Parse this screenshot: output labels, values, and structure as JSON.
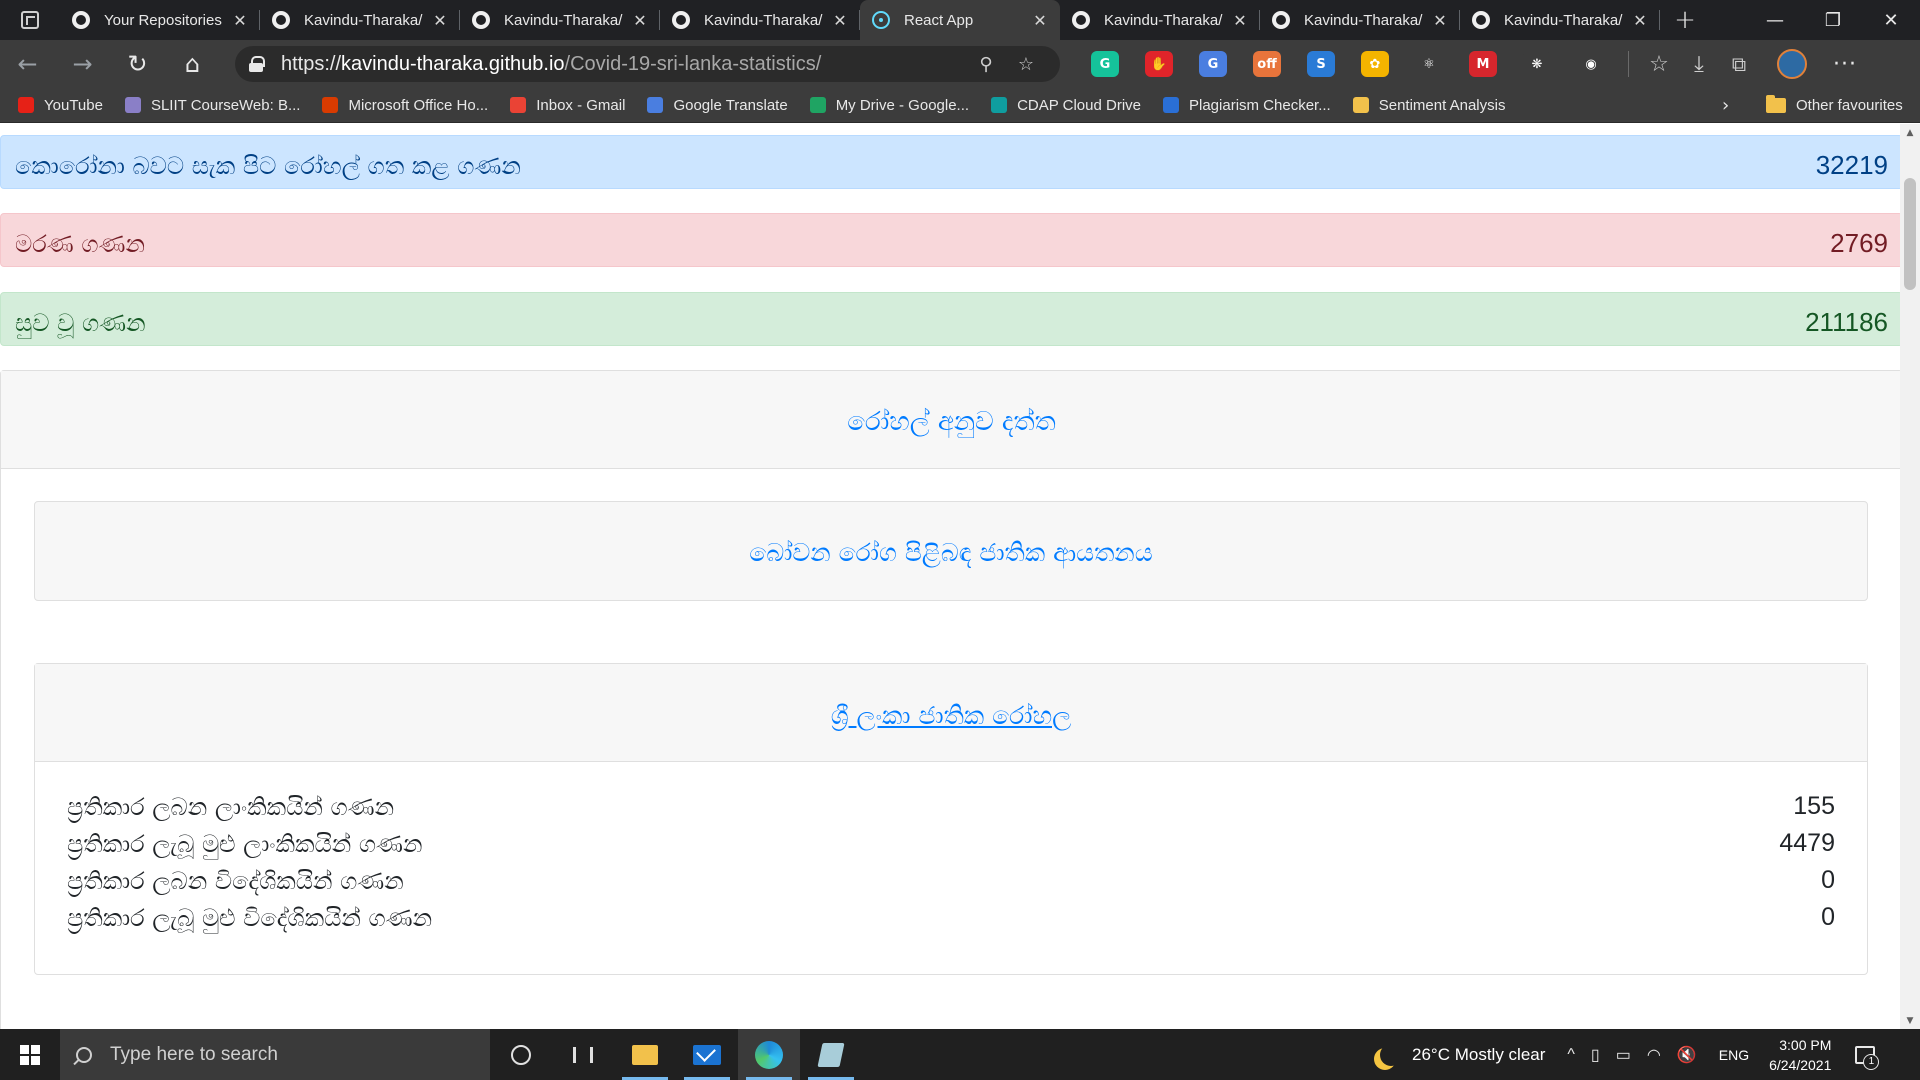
{
  "browser": {
    "tabs": [
      {
        "title": "Your Repositories",
        "icon": "github-icon",
        "active": false
      },
      {
        "title": "Kavindu-Tharaka/",
        "icon": "github-icon",
        "active": false
      },
      {
        "title": "Kavindu-Tharaka/",
        "icon": "github-icon",
        "active": false
      },
      {
        "title": "Kavindu-Tharaka/",
        "icon": "github-icon",
        "active": false
      },
      {
        "title": "React App",
        "icon": "react-icon",
        "active": true
      },
      {
        "title": "Kavindu-Tharaka/",
        "icon": "github-icon",
        "active": false
      },
      {
        "title": "Kavindu-Tharaka/",
        "icon": "github-icon",
        "active": false
      },
      {
        "title": "Kavindu-Tharaka/",
        "icon": "github-icon",
        "active": false
      }
    ],
    "tab_close_glyph": "✕",
    "new_tab_glyph": "+",
    "window_controls": {
      "minimize": "—",
      "restore": "❐",
      "close": "✕"
    },
    "address": {
      "scheme": "https://",
      "host": "kavindu-tharaka.github.io",
      "path": "/Covid-19-sri-lanka-statistics/"
    },
    "nav_glyphs": {
      "back": "←",
      "forward": "→",
      "refresh": "↻",
      "home": "⌂"
    },
    "omni_glyphs": {
      "zoom": "⚲",
      "favorite": "☆"
    },
    "extensions": [
      {
        "name": "grammarly-icon",
        "color": "#15c39a",
        "label": "G"
      },
      {
        "name": "adblock-icon",
        "color": "#e0242a",
        "label": "✋"
      },
      {
        "name": "translate-icon",
        "color": "#4a7ee0",
        "label": "G"
      },
      {
        "name": "ext-off-icon",
        "color": "#e8743b",
        "label": "off"
      },
      {
        "name": "shield-ext-icon",
        "color": "#2a7bd6",
        "label": "S"
      },
      {
        "name": "flower-ext-icon",
        "color": "#f4b400",
        "label": "✿"
      },
      {
        "name": "react-devtools-icon",
        "color": "#3c3c3c",
        "label": "⚛"
      },
      {
        "name": "mendeley-icon",
        "color": "#d7262d",
        "label": "M"
      },
      {
        "name": "openai-ext-icon",
        "color": "#3c3c3c",
        "label": "❋"
      },
      {
        "name": "cookie-ext-icon",
        "color": "#3c3c3c",
        "label": "◉"
      }
    ],
    "toolbar_glyphs": {
      "favorites": "☆",
      "downloads": "⤓",
      "collections": "⧉",
      "more": "···"
    },
    "bookmarks": [
      {
        "label": "YouTube",
        "color": "#e62117"
      },
      {
        "label": "SLIIT CourseWeb: B...",
        "color": "#8a7fc7"
      },
      {
        "label": "Microsoft Office Ho...",
        "color": "#d83b01"
      },
      {
        "label": "Inbox - Gmail",
        "color": "#ea4335"
      },
      {
        "label": "Google Translate",
        "color": "#4a7ee0"
      },
      {
        "label": "My Drive - Google...",
        "color": "#1fa463"
      },
      {
        "label": "CDAP Cloud Drive",
        "color": "#0f9d9f"
      },
      {
        "label": "Plagiarism Checker...",
        "color": "#2a6fd6"
      },
      {
        "label": "Sentiment Analysis",
        "color": "#f2c14b"
      }
    ],
    "bookmarks_overflow": "›",
    "other_favourites": "Other favourites"
  },
  "page": {
    "summary": [
      {
        "label": "කොරෝනා බවට සැක පිට රෝහල් ගත කළ ගණන",
        "value": "32219",
        "style": "blue"
      },
      {
        "label": "මරණ ගණන",
        "value": "2769",
        "style": "red"
      },
      {
        "label": "සුව වූ ගණන",
        "value": "211186",
        "style": "green"
      }
    ],
    "hospital_section_title": "රෝහල් අනුව දත්ත",
    "institute_title": "බෝවන රෝග පිළිබඳ ජාතික ආයතනය",
    "hospital_name": "ශ්‍රී ලංකා ජාතික රෝහල",
    "hospital_stats": [
      {
        "label": "ප්‍රතිකාර ලබන ලාංකිකයින් ගණන",
        "value": "155"
      },
      {
        "label": "ප්‍රතිකාර ලැබූ මුළු ලාංකිකයින් ගණන",
        "value": "4479"
      },
      {
        "label": "ප්‍රතිකාර ලබන විදේශිකයින් ගණන",
        "value": "0"
      },
      {
        "label": "ප්‍රතිකාර ලැබූ මුළු විදේශිකයින් ගණන",
        "value": "0"
      }
    ]
  },
  "taskbar": {
    "search_placeholder": "Type here to search",
    "weather": "26°C  Mostly clear",
    "tray_glyphs": {
      "chevron": "^",
      "usb": "▯",
      "battery": "▭",
      "wifi": "◠",
      "volume": "🔇"
    },
    "language": "ENG",
    "time": "3:00 PM",
    "date": "6/24/2021",
    "notification_count": "1"
  }
}
